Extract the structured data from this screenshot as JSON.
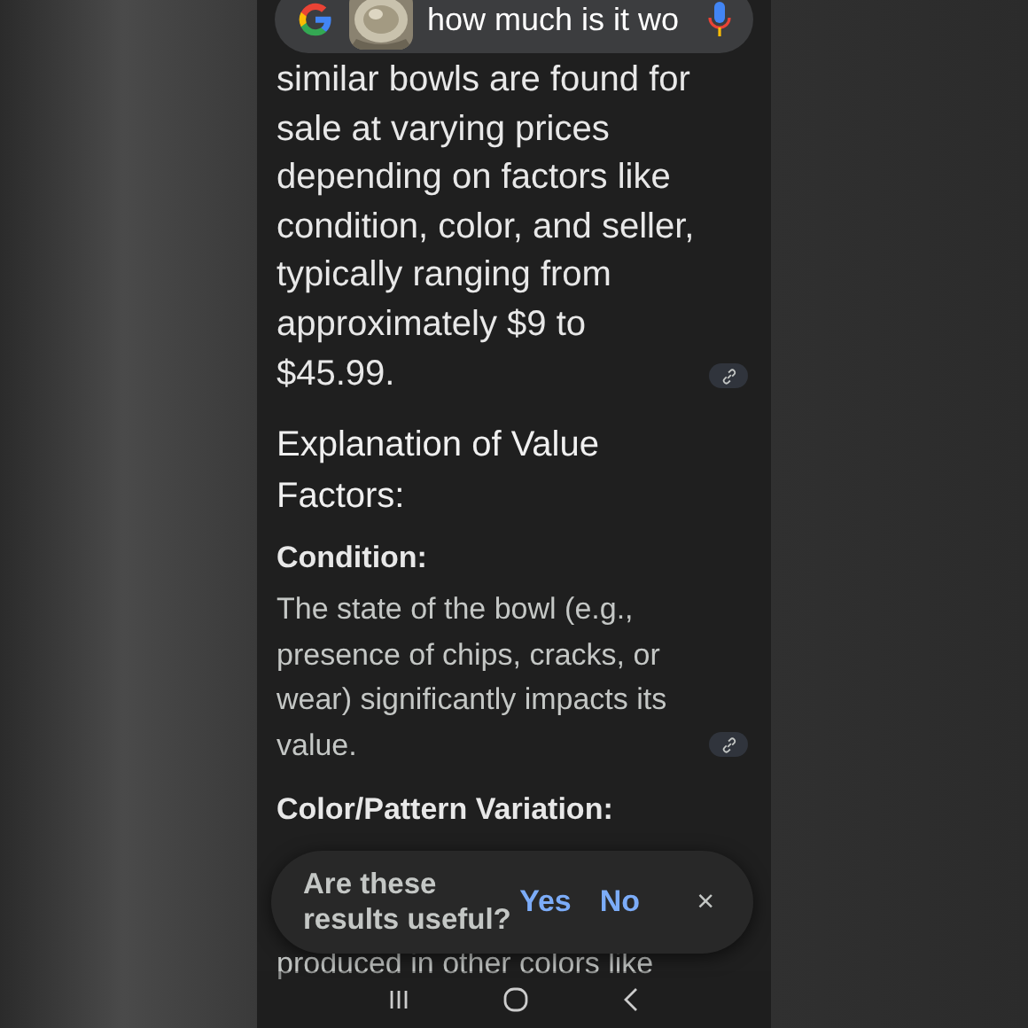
{
  "search_bar": {
    "query": "how much is it wo"
  },
  "blocks": [
    {
      "kind": "paragraph",
      "text": "similar bowls are found for sale at varying prices depending on factors like condition, color, and seller, typically ranging from approximately $9 to $45.99.",
      "source_link": true
    },
    {
      "kind": "heading",
      "text": "Explanation of Value Factors:",
      "source_link": false
    },
    {
      "kind": "subheading",
      "text": "Condition:",
      "source_link": false
    },
    {
      "kind": "body",
      "text": "The state of the bowl (e.g., presence of chips, cracks, or wear) significantly impacts its value.",
      "source_link": true
    },
    {
      "kind": "subheading",
      "text": "Color/Pattern Variation:",
      "source_link": false
    },
    {
      "kind": "tail",
      "text": "produced in other colors like"
    }
  ],
  "feedback": {
    "question": "Are these results useful?",
    "yes": "Yes",
    "no": "No",
    "close": "×"
  }
}
